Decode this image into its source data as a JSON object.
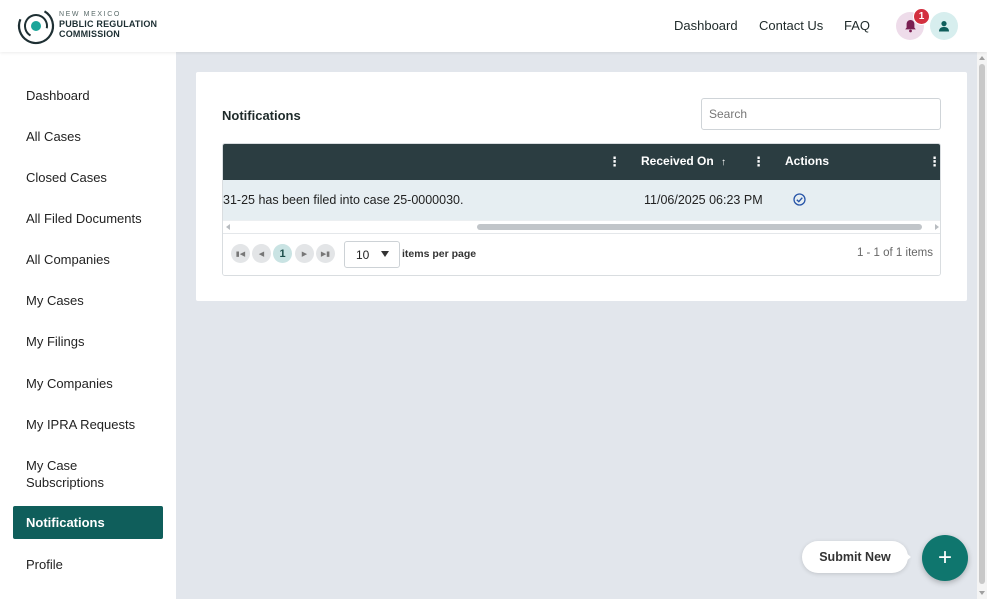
{
  "brand": {
    "line1": "NEW MEXICO",
    "line2": "PUBLIC REGULATION",
    "line3": "COMMISSION",
    "primary_color": "#0f5e5b",
    "accent_color": "#0f766e"
  },
  "header": {
    "nav": [
      {
        "label": "Dashboard"
      },
      {
        "label": "Contact Us"
      },
      {
        "label": "FAQ"
      }
    ],
    "notifications_badge": "1",
    "bell_icon": "bell-icon",
    "user_icon": "user-icon"
  },
  "sidebar": {
    "items": [
      {
        "label": "Dashboard"
      },
      {
        "label": "All Cases"
      },
      {
        "label": "Closed Cases"
      },
      {
        "label": "All Filed Documents"
      },
      {
        "label": "All Companies"
      },
      {
        "label": "My Cases"
      },
      {
        "label": "My Filings"
      },
      {
        "label": "My Companies"
      },
      {
        "label": "My IPRA Requests"
      },
      {
        "label": "My Case Subscriptions"
      },
      {
        "label": "Notifications",
        "active": true
      },
      {
        "label": "Profile"
      }
    ]
  },
  "main": {
    "title": "Notifications",
    "search": {
      "placeholder": "Search",
      "value": ""
    },
    "grid": {
      "columns": [
        {
          "label": "",
          "menu_icon": "kebab-icon"
        },
        {
          "label": "Received On",
          "sort_icon": "arrow-up-icon",
          "menu_icon": "kebab-icon"
        },
        {
          "label": "Actions",
          "menu_icon": "kebab-icon"
        }
      ],
      "rows": [
        {
          "message": "31-25 has been filed into case 25-0000030.",
          "received_on": "11/06/2025 06:23 PM",
          "action_icon": "check-circle-icon"
        }
      ]
    },
    "pager": {
      "current_page": "1",
      "page_size": "10",
      "page_size_label": "items per page",
      "info": "1 - 1 of 1 items"
    }
  },
  "fab": {
    "label": "Submit New",
    "icon_glyph": "+"
  }
}
